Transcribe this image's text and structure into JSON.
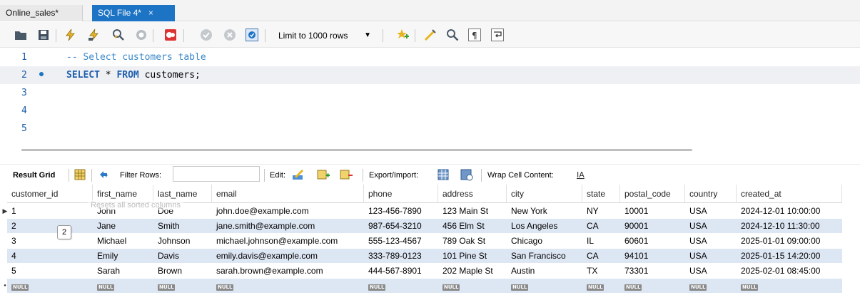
{
  "tabs": [
    {
      "label": "Online_sales*",
      "active": false
    },
    {
      "label": "SQL File 4*",
      "active": true,
      "close": "×"
    }
  ],
  "toolbar": {
    "limit_label": "Limit to 1000 rows",
    "icons": [
      "folder-open-icon",
      "save-icon",
      "execute-icon",
      "execute-current-icon",
      "explain-icon",
      "stop-icon",
      "toggle-error-icon",
      "commit-icon",
      "rollback-icon",
      "autocommit-icon",
      "limit-dropdown",
      "bookmark-icon",
      "beautify-icon",
      "find-icon",
      "invisible-chars-icon",
      "wrap-icon"
    ]
  },
  "editor": {
    "lines": [
      {
        "num": "1",
        "text": "-- Select customers table",
        "type": "comment"
      },
      {
        "num": "2",
        "kw1": "SELECT",
        "mid": " * ",
        "kw2": "FROM",
        "rest": " customers;",
        "type": "sql",
        "current": true
      },
      {
        "num": "3",
        "text": ""
      },
      {
        "num": "4",
        "text": ""
      },
      {
        "num": "5",
        "text": ""
      }
    ]
  },
  "result_toolbar": {
    "result_grid": "Result Grid",
    "filter_rows": "Filter Rows:",
    "edit": "Edit:",
    "export_import": "Export/Import:",
    "wrap": "Wrap Cell Content:"
  },
  "grid": {
    "columns": [
      "customer_id",
      "first_name",
      "last_name",
      "email",
      "phone",
      "address",
      "city",
      "state",
      "postal_code",
      "country",
      "created_at"
    ],
    "rows": [
      [
        "1",
        "John",
        "Doe",
        "john.doe@example.com",
        "123-456-7890",
        "123 Main St",
        "New York",
        "NY",
        "10001",
        "USA",
        "2024-12-01 10:00:00"
      ],
      [
        "2",
        "Jane",
        "Smith",
        "jane.smith@example.com",
        "987-654-3210",
        "456 Elm St",
        "Los Angeles",
        "CA",
        "90001",
        "USA",
        "2024-12-10 11:30:00"
      ],
      [
        "3",
        "Michael",
        "Johnson",
        "michael.johnson@example.com",
        "555-123-4567",
        "789 Oak St",
        "Chicago",
        "IL",
        "60601",
        "USA",
        "2025-01-01 09:00:00"
      ],
      [
        "4",
        "Emily",
        "Davis",
        "emily.davis@example.com",
        "333-789-0123",
        "101 Pine St",
        "San Francisco",
        "CA",
        "94101",
        "USA",
        "2025-01-15 14:20:00"
      ],
      [
        "5",
        "Sarah",
        "Brown",
        "sarah.brown@example.com",
        "444-567-8901",
        "202 Maple St",
        "Austin",
        "TX",
        "73301",
        "USA",
        "2025-02-01 08:45:00"
      ]
    ],
    "null_label": "NULL",
    "tooltip": "Resets all sorted columns",
    "badge": "2"
  },
  "colors": {
    "accent": "#1d74c4",
    "alt_row": "#dde6f3"
  }
}
